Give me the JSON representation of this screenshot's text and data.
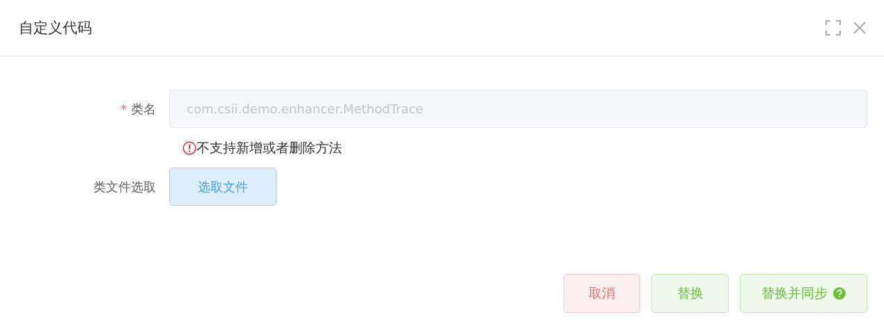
{
  "dialog": {
    "title": "自定义代码"
  },
  "form": {
    "class_name": {
      "label": "类名",
      "required_mark": "*",
      "value": "com.csii.demo.enhancer.MethodTrace",
      "disabled": true,
      "error": "不支持新增或者删除方法"
    },
    "class_file": {
      "label": "类文件选取",
      "button": "选取文件"
    }
  },
  "buttons": [
    {
      "label": "取消",
      "kind": "danger",
      "help": false
    },
    {
      "label": "替换",
      "kind": "success",
      "help": false
    },
    {
      "label": "替换并同步",
      "kind": "success",
      "help": true
    }
  ]
}
